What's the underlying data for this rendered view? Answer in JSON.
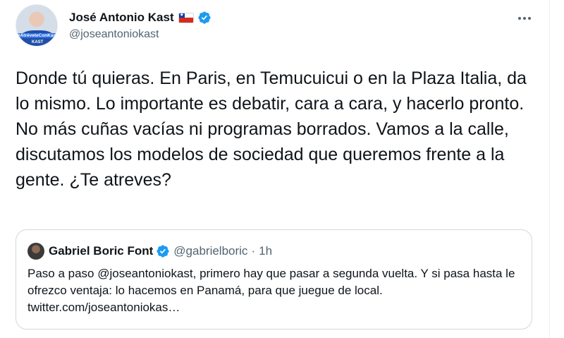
{
  "tweet": {
    "author": {
      "display_name": "José Antonio Kast",
      "handle": "@joseantoniokast",
      "flag": "chile-flag",
      "verified_icon": "verified-badge-icon",
      "avatar_hashtag": "#AtréveteConKast",
      "avatar_logo": "KAST"
    },
    "text": "Donde tú quieras. En Paris, en Temucuicui o en la Plaza Italia, da lo mismo. Lo importante es debatir, cara a cara, y hacerlo pronto. No más cuñas vacías ni programas borrados. Vamos a la calle, discutamos los modelos de sociedad que queremos frente a la gente. ¿Te atreves?",
    "more_icon": "more-options-icon"
  },
  "quoted_tweet": {
    "display_name": "Gabriel Boric Font",
    "handle": "@gabrielboric",
    "separator": "·",
    "time": "1h",
    "text": "Paso a paso @joseantoniokast, primero hay que pasar a segunda vuelta. Y si pasa hasta le ofrezco ventaja: lo hacemos en Panamá, para que juegue de local. twitter.com/joseantoniokas…"
  },
  "colors": {
    "text_primary": "#0f1419",
    "text_secondary": "#536471",
    "verified_blue": "#1d9bf0",
    "border": "#cfd9de"
  }
}
